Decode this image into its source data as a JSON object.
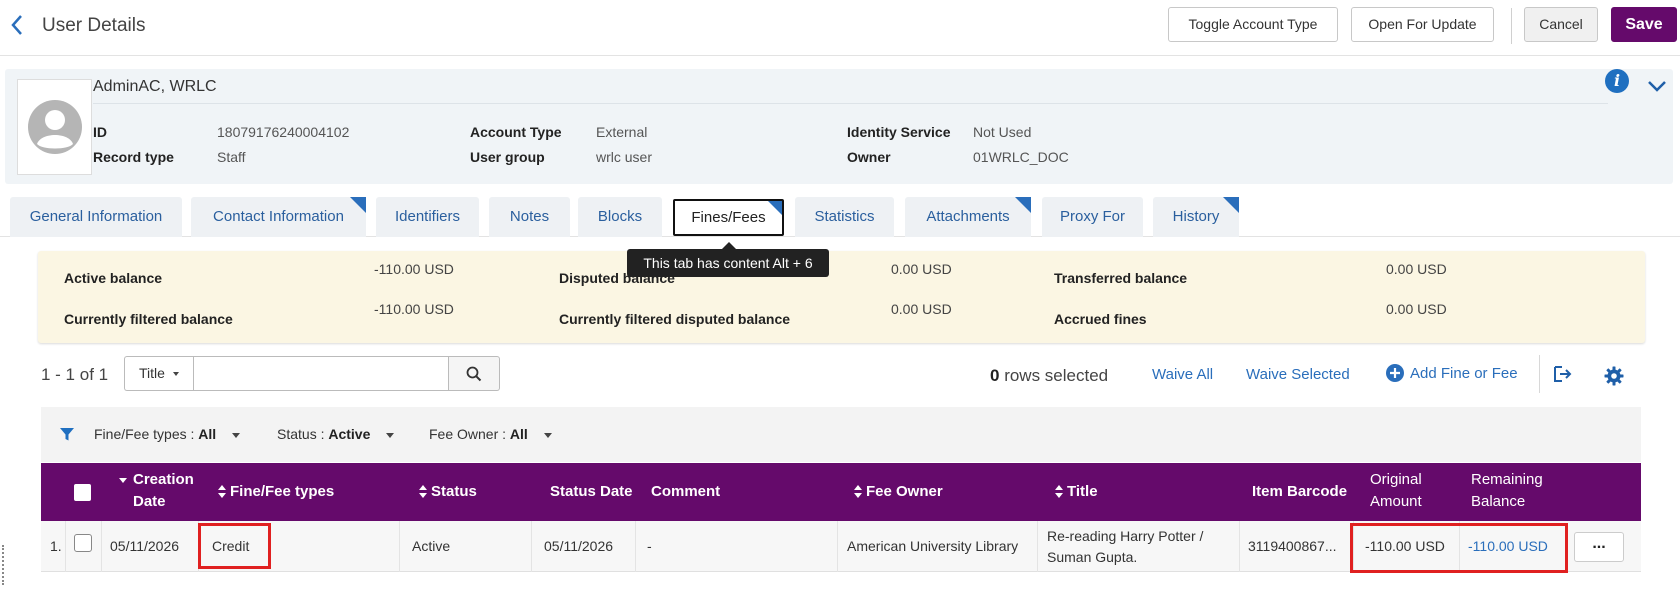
{
  "header": {
    "title": "User Details",
    "toggle_account_type": "Toggle Account Type",
    "open_for_update": "Open For Update",
    "cancel": "Cancel",
    "save": "Save"
  },
  "user": {
    "name": "AdminAC, WRLC",
    "id_label": "ID",
    "id_value": "18079176240004102",
    "record_type_label": "Record type",
    "record_type_value": "Staff",
    "account_type_label": "Account Type",
    "account_type_value": "External",
    "user_group_label": "User group",
    "user_group_value": "wrlc user",
    "identity_service_label": "Identity Service",
    "identity_service_value": "Not Used",
    "owner_label": "Owner",
    "owner_value": "01WRLC_DOC"
  },
  "tabs": [
    {
      "label": "General Information"
    },
    {
      "label": "Contact Information"
    },
    {
      "label": "Identifiers"
    },
    {
      "label": "Notes"
    },
    {
      "label": "Blocks"
    },
    {
      "label": "Fines/Fees"
    },
    {
      "label": "Statistics"
    },
    {
      "label": "Attachments"
    },
    {
      "label": "Proxy For"
    },
    {
      "label": "History"
    }
  ],
  "tooltip": "This tab has content Alt + 6",
  "balances": {
    "active_label": "Active balance",
    "active_value": "-110.00 USD",
    "filtered_label": "Currently filtered balance",
    "filtered_value": "-110.00 USD",
    "disputed_label": "Disputed balance",
    "disputed_value": "0.00 USD",
    "filtered_disputed_label": "Currently filtered disputed balance",
    "filtered_disputed_value": "0.00 USD",
    "transferred_label": "Transferred balance",
    "transferred_value": "0.00 USD",
    "accrued_label": "Accrued fines",
    "accrued_value": "0.00 USD"
  },
  "toolbar": {
    "count": "1 - 1 of 1",
    "search_scope": "Title",
    "search_value": "",
    "rows_selected_count": "0",
    "rows_selected_text": " rows selected",
    "waive_all": "Waive All",
    "waive_selected": "Waive Selected",
    "add_fine": "Add Fine or Fee"
  },
  "filters": {
    "type_label": "Fine/Fee types : ",
    "type_value": "All",
    "status_label": "Status : ",
    "status_value": "Active",
    "owner_label": "Fee Owner : ",
    "owner_value": "All"
  },
  "table": {
    "headers": {
      "creation_date_1": "Creation",
      "creation_date_2": "Date",
      "types": "Fine/Fee types",
      "status": "Status",
      "status_date": "Status Date",
      "comment": "Comment",
      "fee_owner": "Fee Owner",
      "title": "Title",
      "item_barcode": "Item Barcode",
      "original_1": "Original",
      "original_2": "Amount",
      "remaining_1": "Remaining",
      "remaining_2": "Balance"
    },
    "rows": [
      {
        "index": "1.",
        "creation_date": "05/11/2026",
        "type": "Credit",
        "status": "Active",
        "status_date": "05/11/2026",
        "comment": "-",
        "fee_owner": "American University Library",
        "title_1": "Re-reading Harry Potter /",
        "title_2": "Suman Gupta.",
        "item_barcode": "3119400867...",
        "original_amount": "-110.00 USD",
        "remaining_balance": "-110.00 USD",
        "more": "..."
      }
    ]
  },
  "colors": {
    "accent": "#650a6b",
    "link": "#2a6ebb",
    "highlight": "#e02020"
  }
}
